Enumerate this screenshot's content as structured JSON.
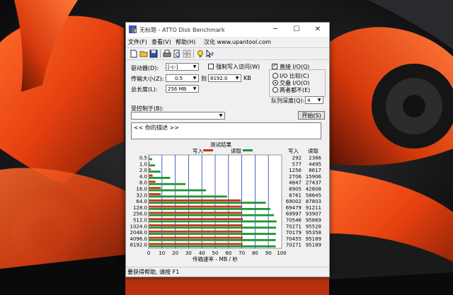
{
  "window": {
    "title": "无标题 - ATTO Disk Benchmark",
    "menu": [
      "文件(F)",
      "查看(V)",
      "帮助(H)",
      "汉化 www.upantool.com"
    ]
  },
  "settings": {
    "drive_label": "驱动器(D):",
    "drive_value": "[-c-]",
    "transfer_label": "传输大小(Z):",
    "transfer_from": "0.5",
    "to_label": "到",
    "transfer_to": "8192.0",
    "kb_label": "KB",
    "length_label": "总长度(L):",
    "length_value": "256 MB",
    "force_write_label": "强制写入访问(W)",
    "direct_io_label": "直接 I/O(Q)",
    "io_compare_label": "I/O 比较(C)",
    "overlapped_io_label": "交叠 I/O(O)",
    "neither_label": "两者都不(E)",
    "queue_label": "队列深度(Q):",
    "queue_value": "4",
    "controlled_by_label": "受控制于(B):",
    "start_button": "开始(S)",
    "description": "<<   你的描述   >>"
  },
  "chart_data": {
    "type": "bar",
    "title": "测试结果",
    "legend": [
      "写入",
      "读取"
    ],
    "xlabel": "传输速率 - MB / 秒",
    "xlim": [
      0,
      100
    ],
    "x_ticks": [
      "0",
      "10",
      "20",
      "30",
      "40",
      "50",
      "60",
      "70",
      "80",
      "90",
      "100"
    ],
    "categories": [
      "0.5",
      "1.0",
      "2.0",
      "4.0",
      "8.0",
      "16.0",
      "32.0",
      "64.0",
      "128.0",
      "256.0",
      "512.0",
      "1024.0",
      "2048.0",
      "4096.0",
      "8192.0"
    ],
    "column_headers": [
      "写入",
      "读取"
    ],
    "series": [
      {
        "name": "写入",
        "color": "#c8321e",
        "values": [
          292,
          577,
          1256,
          2706,
          4847,
          8905,
          8761,
          69002,
          69479,
          69997,
          70546,
          70271,
          70179,
          70455,
          70271
        ]
      },
      {
        "name": "读取",
        "color": "#1e9632",
        "values": [
          2366,
          4495,
          8617,
          15906,
          27437,
          42808,
          58645,
          87803,
          91211,
          93907,
          95869,
          95528,
          95358,
          95189,
          95189
        ]
      }
    ]
  },
  "status": "要获得帮助, 请按 F1"
}
